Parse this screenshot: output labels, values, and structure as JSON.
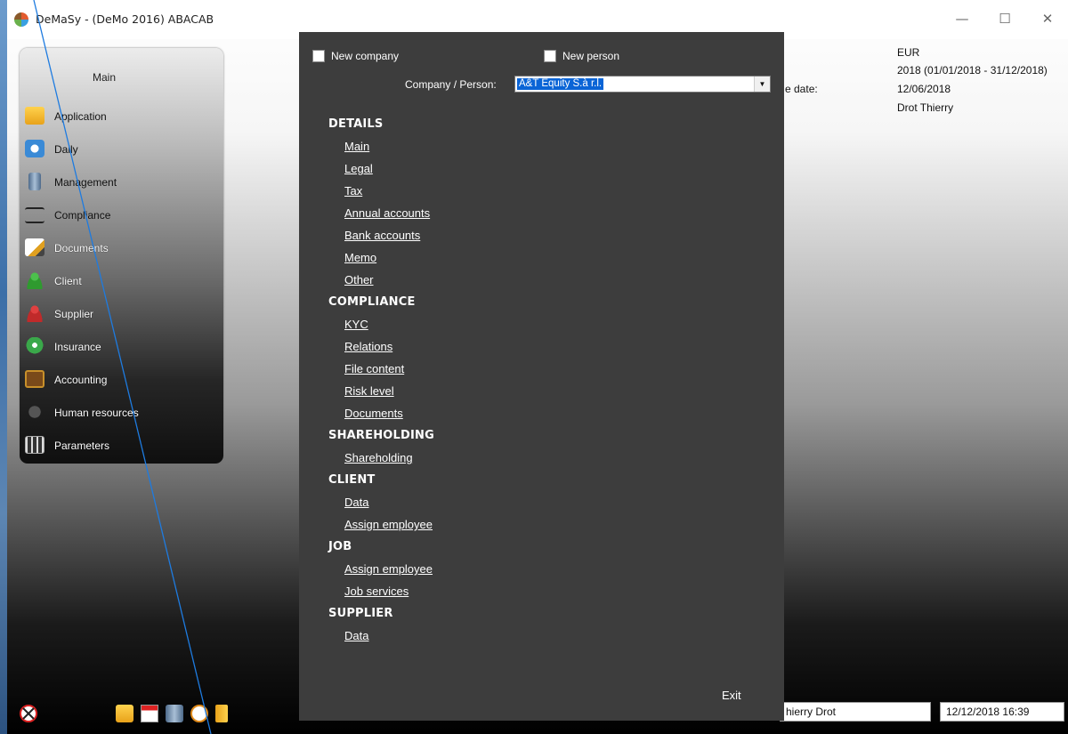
{
  "window": {
    "title": "DeMaSy - (DeMo 2016) ABACAB",
    "min_glyph": "—",
    "max_glyph": "☐",
    "close_glyph": "✕"
  },
  "nav": {
    "title": "Main",
    "items": [
      {
        "label": "Application",
        "icon": "folder-icon"
      },
      {
        "label": "Daily",
        "icon": "clock-icon"
      },
      {
        "label": "Management",
        "icon": "trash-bin-icon"
      },
      {
        "label": "Compliance",
        "icon": "checklist-icon"
      },
      {
        "label": "Documents",
        "icon": "pencil-document-icon"
      },
      {
        "label": "Client",
        "icon": "person-green-icon"
      },
      {
        "label": "Supplier",
        "icon": "person-red-icon"
      },
      {
        "label": "Insurance",
        "icon": "house-hand-icon"
      },
      {
        "label": "Accounting",
        "icon": "abacus-icon"
      },
      {
        "label": "Human resources",
        "icon": "magnifier-person-icon"
      },
      {
        "label": "Parameters",
        "icon": "sliders-icon"
      }
    ]
  },
  "info": {
    "currency": "EUR",
    "period": "2018  (01/01/2018 - 31/12/2018)",
    "date_label_partial": "e date:",
    "date": "12/06/2018",
    "user": "Drot Thierry"
  },
  "dialog": {
    "new_company_label": "New company",
    "new_person_label": "New person",
    "company_person_label": "Company / Person:",
    "company_person_value": "A&T Equity S.à r.l.",
    "sections": [
      {
        "title": "DETAILS",
        "links": [
          "Main",
          "Legal",
          "Tax",
          "Annual accounts",
          "Bank accounts",
          "Memo",
          "Other"
        ]
      },
      {
        "title": "COMPLIANCE",
        "links": [
          "KYC",
          "Relations",
          "File content",
          "Risk level",
          "Documents"
        ]
      },
      {
        "title": "SHAREHOLDING",
        "links": [
          "Shareholding"
        ]
      },
      {
        "title": "CLIENT",
        "links": [
          "Data",
          "Assign employee"
        ]
      },
      {
        "title": "JOB",
        "links": [
          "Assign employee",
          "Job services"
        ]
      },
      {
        "title": "SUPPLIER",
        "links": [
          "Data"
        ]
      }
    ],
    "exit_label": "Exit"
  },
  "statusbar": {
    "user": "hierry Drot",
    "datetime": "12/12/2018 16:39"
  },
  "colors": {
    "dialog_bg": "#3d3d3d",
    "selection": "#0a64d6",
    "annotation_line": "#1e7be0"
  }
}
